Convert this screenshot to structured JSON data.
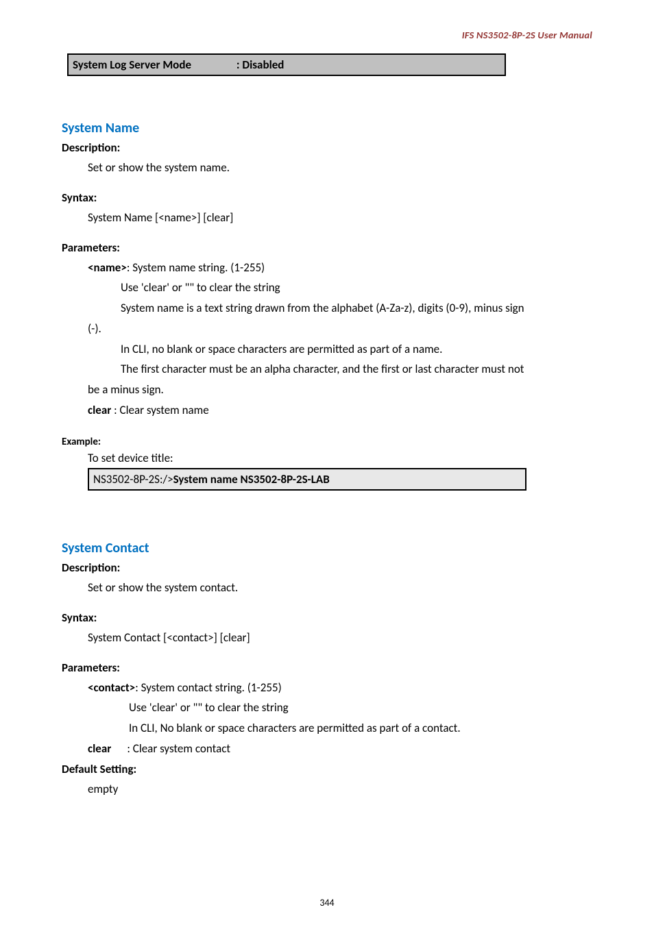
{
  "header": {
    "doc_title": "IFS  NS3502-8P-2S  User  Manual"
  },
  "top_box": {
    "label": "System Log Server Mode",
    "value": ": Disabled"
  },
  "sys_name": {
    "title": "System Name",
    "description_label": "Description:",
    "description_text": "Set or show the system name.",
    "syntax_label": "Syntax:",
    "syntax_text": "System Name [<name>] [clear]",
    "params_label": "Parameters:",
    "param_name_key": "<name>",
    "param_name_rest": ": System name string. (1-255)",
    "param_line2": "Use 'clear' or \"\" to clear the string",
    "param_line3": "System name is a text string drawn from the alphabet (A-Za-z), digits (0-9), minus sign",
    "param_line4_prefix": "(-).",
    "param_line5": "In CLI, no blank or space characters are permitted as part of a name.",
    "param_line6": "The first character must be an alpha character, and the first or last character must not",
    "param_line7": "be a minus sign.",
    "param_clear_key": "clear",
    "param_clear_rest": " : Clear system name",
    "example_label": "Example:",
    "example_text": "To set device title:",
    "example_box_prefix": "NS3502-8P-2S:/>",
    "example_box_cmd": "System name NS3502-8P-2S-LAB"
  },
  "sys_contact": {
    "title": "System Contact",
    "description_label": "Description:",
    "description_text": "Set or show the system contact.",
    "syntax_label": "Syntax:",
    "syntax_text": "System Contact [<contact>] [clear]",
    "params_label": "Parameters:",
    "param_contact_key": "<contact>",
    "param_contact_rest": ": System contact string. (1-255)",
    "param_line2": "Use 'clear' or \"\" to clear the string",
    "param_line3": "In CLI, No blank or space characters are permitted as part of a contact.",
    "param_clear_key": "clear",
    "param_clear_rest": "      : Clear system contact",
    "default_label": "Default Setting:",
    "default_text": "empty"
  },
  "footer": {
    "page_number": "344"
  }
}
